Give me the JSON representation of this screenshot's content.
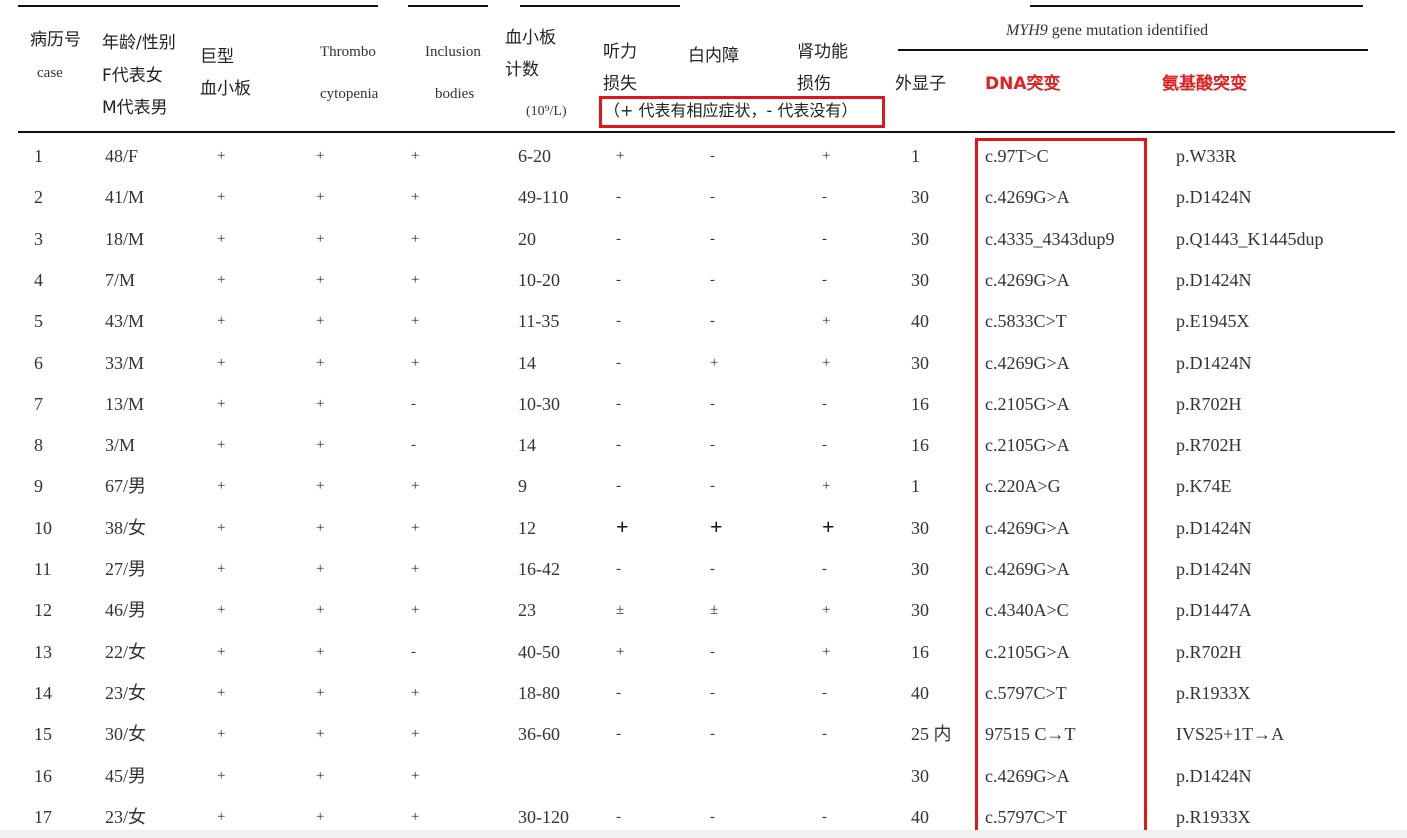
{
  "headers": {
    "case_cn": "病历号",
    "case_en": "case",
    "age": [
      "年龄/性别",
      "F代表女",
      "M代表男"
    ],
    "giant": [
      "巨型",
      "血小板"
    ],
    "thrombo": [
      "Thrombo",
      "cytopenia"
    ],
    "inclusion": [
      "Inclusion",
      "bodies"
    ],
    "platelet": [
      "血小板",
      "计数",
      "(10⁹/L)"
    ],
    "hearing": [
      "听力",
      "损失"
    ],
    "cataract": "白内障",
    "renal": [
      "肾功能",
      "损伤"
    ],
    "symptom_note": "（+ 代表有相应症状，- 代表没有）",
    "mutation_title_gene": "MYH9",
    "mutation_title_rest": "gene mutation identified",
    "exon": "外显子",
    "dna": "DNA突变",
    "aa": "氨基酸突变"
  },
  "rows": [
    {
      "case": "1",
      "age": "48/F",
      "giant": "+",
      "thrombo": "+",
      "incl": "+",
      "plt": "6-20",
      "hear": "+",
      "cat": "-",
      "renal": "+",
      "exon": "1",
      "dna": "c.97T>C",
      "aa": "p.W33R"
    },
    {
      "case": "2",
      "age": "41/M",
      "giant": "+",
      "thrombo": "+",
      "incl": "+",
      "plt": "49-110",
      "hear": "-",
      "cat": "-",
      "renal": "-",
      "exon": "30",
      "dna": "c.4269G>A",
      "aa": "p.D1424N"
    },
    {
      "case": "3",
      "age": "18/M",
      "giant": "+",
      "thrombo": "+",
      "incl": "+",
      "plt": "20",
      "hear": "-",
      "cat": "-",
      "renal": "-",
      "exon": "30",
      "dna": "c.4335_4343dup9",
      "aa": "p.Q1443_K1445dup"
    },
    {
      "case": "4",
      "age": "7/M",
      "giant": "+",
      "thrombo": "+",
      "incl": "+",
      "plt": "10-20",
      "hear": "-",
      "cat": "-",
      "renal": "-",
      "exon": "30",
      "dna": "c.4269G>A",
      "aa": "p.D1424N"
    },
    {
      "case": "5",
      "age": "43/M",
      "giant": "+",
      "thrombo": "+",
      "incl": "+",
      "plt": "11-35",
      "hear": "-",
      "cat": "-",
      "renal": "+",
      "exon": "40",
      "dna": "c.5833C>T",
      "aa": "p.E1945X"
    },
    {
      "case": "6",
      "age": "33/M",
      "giant": "+",
      "thrombo": "+",
      "incl": "+",
      "plt": "14",
      "hear": "-",
      "cat": "+",
      "renal": "+",
      "exon": "30",
      "dna": "c.4269G>A",
      "aa": "p.D1424N"
    },
    {
      "case": "7",
      "age": "13/M",
      "giant": "+",
      "thrombo": "+",
      "incl": "-",
      "plt": "10-30",
      "hear": "-",
      "cat": "-",
      "renal": "-",
      "exon": "16",
      "dna": "c.2105G>A",
      "aa": "p.R702H"
    },
    {
      "case": "8",
      "age": "3/M",
      "giant": "+",
      "thrombo": "+",
      "incl": "-",
      "plt": "14",
      "hear": "-",
      "cat": "-",
      "renal": "-",
      "exon": "16",
      "dna": "c.2105G>A",
      "aa": "p.R702H"
    },
    {
      "case": "9",
      "age": "67/男",
      "giant": "+",
      "thrombo": "+",
      "incl": "+",
      "plt": "9",
      "hear": "-",
      "cat": "-",
      "renal": "+",
      "exon": "1",
      "dna": "c.220A>G",
      "aa": "p.K74E"
    },
    {
      "case": "10",
      "age": "38/女",
      "giant": "+",
      "thrombo": "+",
      "incl": "+",
      "plt": "12",
      "hear": "+",
      "cat": "+",
      "renal": "+",
      "exon": "30",
      "dna": "c.4269G>A",
      "aa": "p.D1424N",
      "bigsigns": true
    },
    {
      "case": "11",
      "age": "27/男",
      "giant": "+",
      "thrombo": "+",
      "incl": "+",
      "plt": "16-42",
      "hear": "-",
      "cat": "-",
      "renal": "-",
      "exon": "30",
      "dna": "c.4269G>A",
      "aa": "p.D1424N"
    },
    {
      "case": "12",
      "age": "46/男",
      "giant": "+",
      "thrombo": "+",
      "incl": "+",
      "plt": "23",
      "hear": "±",
      "cat": "±",
      "renal": "+",
      "exon": "30",
      "dna": "c.4340A>C",
      "aa": "p.D1447A"
    },
    {
      "case": "13",
      "age": "22/女",
      "giant": "+",
      "thrombo": "+",
      "incl": "-",
      "plt": "40-50",
      "hear": "+",
      "cat": "-",
      "renal": "+",
      "exon": "16",
      "dna": "c.2105G>A",
      "aa": "p.R702H"
    },
    {
      "case": "14",
      "age": "23/女",
      "giant": "+",
      "thrombo": "+",
      "incl": "+",
      "plt": "18-80",
      "hear": "-",
      "cat": "-",
      "renal": "-",
      "exon": "40",
      "dna": "c.5797C>T",
      "aa": "p.R1933X"
    },
    {
      "case": "15",
      "age": "30/女",
      "giant": "+",
      "thrombo": "+",
      "incl": "+",
      "plt": "36-60",
      "hear": "-",
      "cat": "-",
      "renal": "-",
      "exon": "25 内",
      "dna": "97515 C→T",
      "aa": "IVS25+1T→A"
    },
    {
      "case": "16",
      "age": "45/男",
      "giant": "+",
      "thrombo": "+",
      "incl": "+",
      "plt": "",
      "hear": "",
      "cat": "",
      "renal": "",
      "exon": "30",
      "dna": "c.4269G>A",
      "aa": "p.D1424N"
    },
    {
      "case": "17",
      "age": "23/女",
      "giant": "+",
      "thrombo": "+",
      "incl": "+",
      "plt": "30-120",
      "hear": "-",
      "cat": "-",
      "renal": "-",
      "exon": "40",
      "dna": "c.5797C>T",
      "aa": "p.R1933X"
    }
  ]
}
